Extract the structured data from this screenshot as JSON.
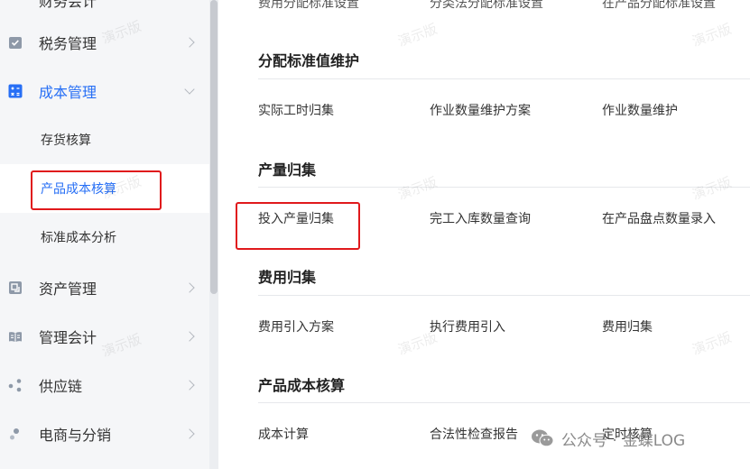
{
  "sidebar": {
    "items": [
      {
        "label": "税务管理",
        "icon": "tax-icon",
        "expanded": false
      },
      {
        "label": "成本管理",
        "icon": "cost-calculator-icon",
        "expanded": true
      },
      {
        "label": "资产管理",
        "icon": "asset-icon",
        "expanded": false
      },
      {
        "label": "管理会计",
        "icon": "management-accounting-icon",
        "expanded": false
      },
      {
        "label": "供应链",
        "icon": "supply-chain-icon",
        "expanded": false
      },
      {
        "label": "电商与分销",
        "icon": "ecommerce-icon",
        "expanded": false
      }
    ],
    "subitems": [
      {
        "label": "存货核算",
        "active": false
      },
      {
        "label": "产品成本核算",
        "active": true
      },
      {
        "label": "标准成本分析",
        "active": false
      }
    ],
    "top_cut_label": "财务会计"
  },
  "main": {
    "top_cut_links": [
      "费用分配标准设置",
      "分类法分配标准设置",
      "在产品分配标准设置"
    ],
    "sections": [
      {
        "title": "分配标准值维护",
        "links": [
          "实际工时归集",
          "作业数量维护方案",
          "作业数量维护"
        ]
      },
      {
        "title": "产量归集",
        "links": [
          "投入产量归集",
          "完工入库数量查询",
          "在产品盘点数量录入"
        ]
      },
      {
        "title": "费用归集",
        "links": [
          "费用引入方案",
          "执行费用引入",
          "费用归集"
        ]
      },
      {
        "title": "产品成本核算",
        "links": [
          "成本计算",
          "合法性检查报告",
          "定时核算"
        ]
      }
    ]
  },
  "watermark_text": "演示版",
  "wechat_footer": {
    "prefix": "公众号 ·",
    "name": "金蝶LOG"
  },
  "colors": {
    "accent": "#276ff5",
    "highlight_box": "#e0191c",
    "sidebar_bg": "#f5f6f8"
  }
}
